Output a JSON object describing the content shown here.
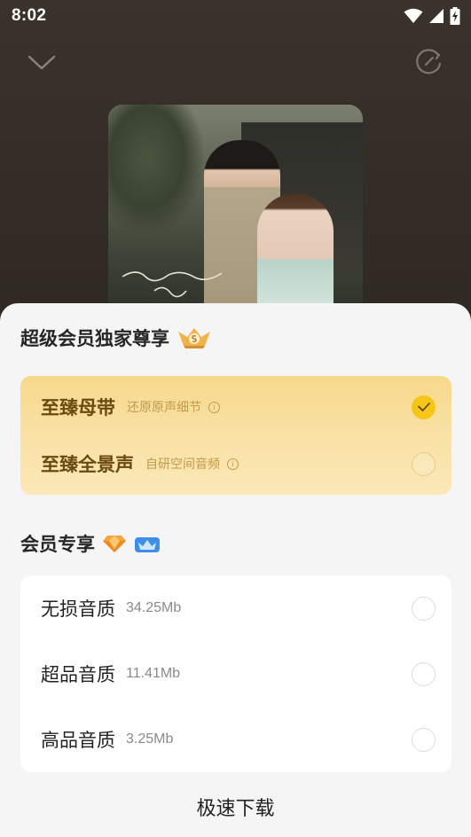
{
  "status_bar": {
    "time": "8:02"
  },
  "cover": {
    "signature_text": "周杰伦 七里香 jay"
  },
  "sheet": {
    "svip_section_title": "超级会员独家尊享",
    "svip_options": [
      {
        "label": "至臻母带",
        "sub": "还原原声细节",
        "selected": true
      },
      {
        "label": "至臻全景声",
        "sub": "自研空间音频",
        "selected": false
      }
    ],
    "vip_section_title": "会员专享",
    "vip_options": [
      {
        "label": "无损音质",
        "size": "34.25Mb"
      },
      {
        "label": "超品音质",
        "size": "11.41Mb"
      },
      {
        "label": "高品音质",
        "size": "3.25Mb"
      }
    ],
    "download_label": "极速下载"
  },
  "colors": {
    "svip_card_top": "#f7d98b",
    "svip_card_bottom": "#fbe8b7",
    "svip_label": "#6b4a12",
    "checked": "#f5c518",
    "sheet_bg": "#f5f5f5"
  },
  "icons": [
    "wifi-icon",
    "signal-icon",
    "battery-charging-icon",
    "chevron-down-icon",
    "refresh-icon",
    "svip-badge-icon",
    "info-icon",
    "check-icon",
    "diamond-icon",
    "vip-crown-icon"
  ]
}
